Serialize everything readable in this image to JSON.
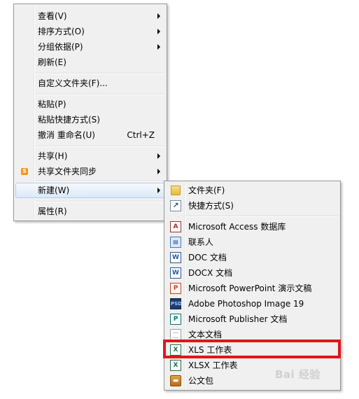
{
  "context_menu": {
    "items": [
      {
        "label": "查看(V)"
      },
      {
        "label": "排序方式(O)"
      },
      {
        "label": "分组依据(P)"
      },
      {
        "label": "刷新(E)"
      },
      {
        "label": "自定义文件夹(F)..."
      },
      {
        "label": "粘贴(P)"
      },
      {
        "label": "粘贴快捷方式(S)"
      },
      {
        "label": "撤消 重命名(U)",
        "shortcut": "Ctrl+Z"
      },
      {
        "label": "共享(H)"
      },
      {
        "label": "共享文件夹同步",
        "icon": "sync-icon"
      },
      {
        "label": "新建(W)"
      },
      {
        "label": "属性(R)"
      }
    ]
  },
  "new_submenu": {
    "items": [
      {
        "label": "文件夹(F)",
        "icon": "folder-icon"
      },
      {
        "label": "快捷方式(S)",
        "icon": "shortcut-icon"
      },
      {
        "label": "Microsoft Access 数据库",
        "icon": "access-icon"
      },
      {
        "label": "联系人",
        "icon": "contact-icon"
      },
      {
        "label": "DOC 文档",
        "icon": "word-icon"
      },
      {
        "label": "DOCX 文档",
        "icon": "word-icon"
      },
      {
        "label": "Microsoft PowerPoint 演示文稿",
        "icon": "powerpoint-icon"
      },
      {
        "label": "Adobe Photoshop Image 19",
        "icon": "photoshop-icon"
      },
      {
        "label": "Microsoft Publisher 文档",
        "icon": "publisher-icon"
      },
      {
        "label": "文本文档",
        "icon": "text-document-icon"
      },
      {
        "label": "XLS 工作表",
        "icon": "excel-icon"
      },
      {
        "label": "XLSX 工作表",
        "icon": "excel-icon"
      },
      {
        "label": "公文包",
        "icon": "briefcase-icon"
      }
    ]
  },
  "annotation": {
    "highlight_color": "#e3141b"
  },
  "watermark": {
    "text": "Bai 经验"
  }
}
